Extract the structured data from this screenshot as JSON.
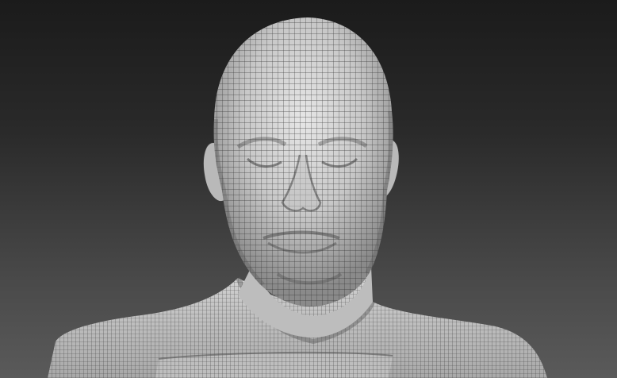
{
  "scene": {
    "subject": "",
    "background_top": "#1b1b1b",
    "background_bottom": "#5a5a5a",
    "mesh_fill": "#cfcfcf",
    "mesh_shadow": "#7a7a7a",
    "wire_color": "#2b2b2b"
  }
}
